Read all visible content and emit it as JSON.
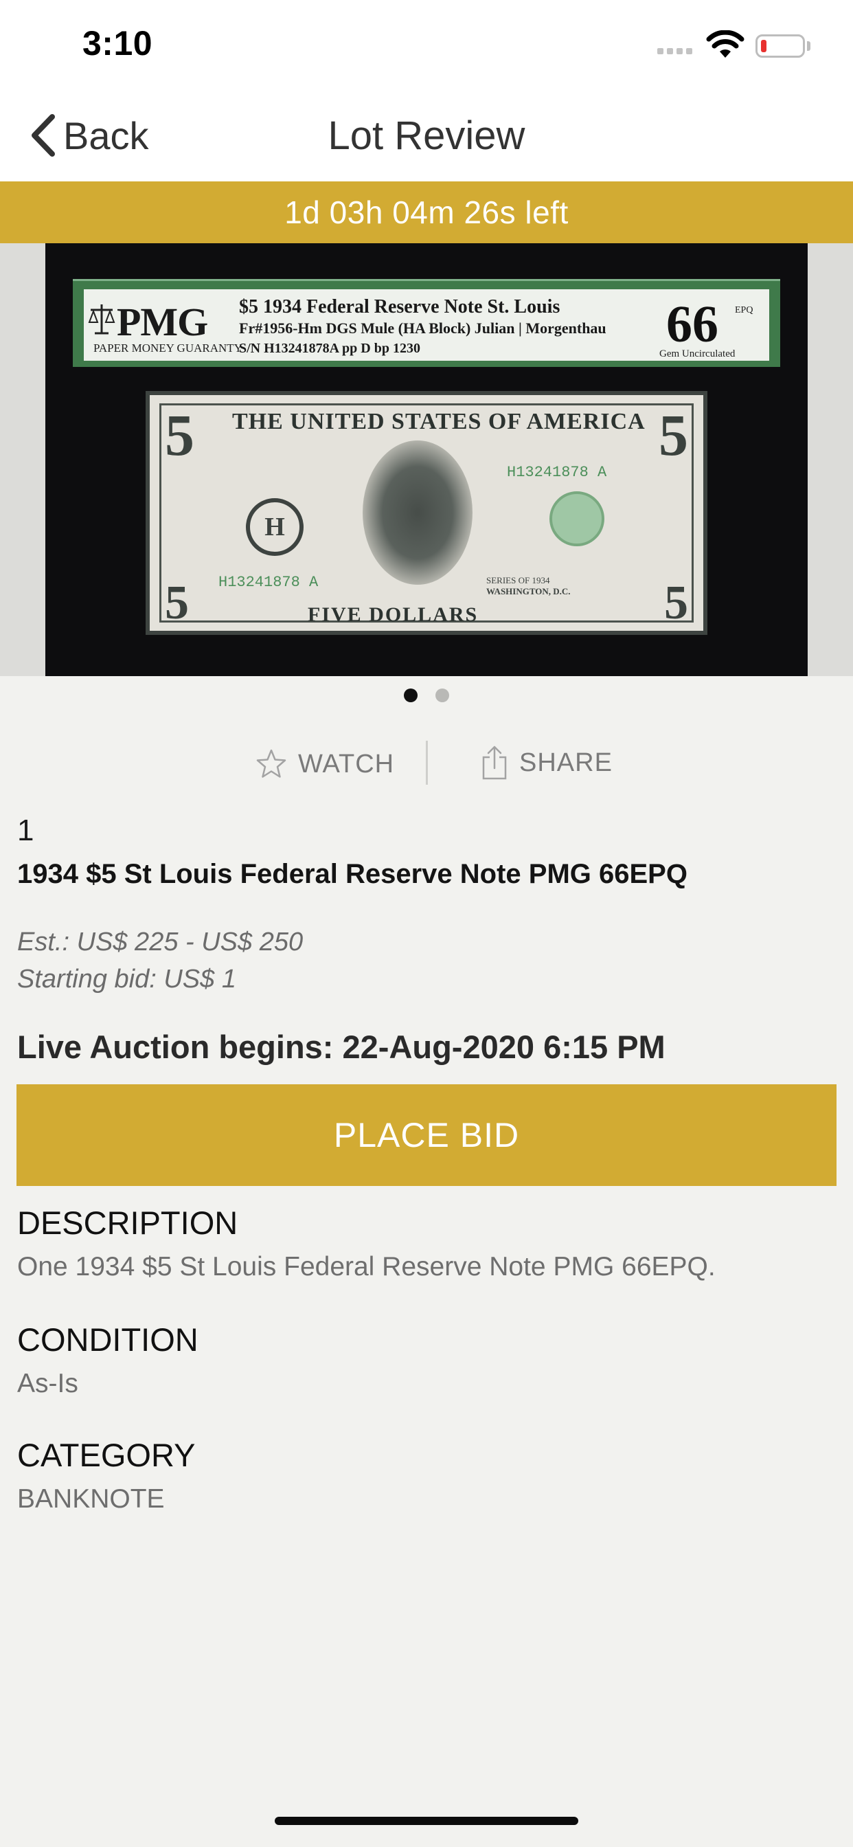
{
  "status_bar": {
    "time": "3:10"
  },
  "nav": {
    "back_label": "Back",
    "title": "Lot Review"
  },
  "timer": {
    "text": "1d 03h 04m 26s left"
  },
  "gallery": {
    "pmg_label": {
      "logo": "PMG",
      "logo_sub": "PAPER MONEY GUARANTY",
      "line1": "$5 1934  Federal Reserve Note St. Louis",
      "line2": "Fr#1956-Hm DGS Mule (HA Block)  Julian | Morgenthau",
      "line3": "S/N H13241878A pp D bp 1230",
      "grade": "66",
      "grade_suffix": "EPQ",
      "grade_sub": "Gem Uncirculated"
    },
    "banknote": {
      "title": "THE UNITED STATES OF AMERICA",
      "bottom": "FIVE DOLLARS",
      "denomination": "5",
      "district_letter": "H",
      "serial": "H13241878 A",
      "series": "SERIES OF 1934",
      "city": "WASHINGTON, D.C."
    },
    "page_count": 2,
    "active_page": 1
  },
  "actions": {
    "watch_label": "WATCH",
    "share_label": "SHARE"
  },
  "lot": {
    "number": "1",
    "title": "1934 $5 St Louis Federal Reserve Note PMG 66EPQ",
    "estimate": "Est.: US$ 225 - US$ 250",
    "starting_bid": "Starting bid: US$ 1",
    "live_auction": "Live Auction begins: 22-Aug-2020 6:15 PM",
    "place_bid_label": "PLACE BID"
  },
  "sections": {
    "description_heading": "DESCRIPTION",
    "description_body": "One 1934 $5 St Louis Federal Reserve Note PMG 66EPQ.",
    "condition_heading": "CONDITION",
    "condition_body": "As-Is",
    "category_heading": "CATEGORY",
    "category_body": "BANKNOTE"
  },
  "colors": {
    "accent": "#d2ab33",
    "background": "#f2f2ef",
    "battery_low": "#e8312f"
  }
}
